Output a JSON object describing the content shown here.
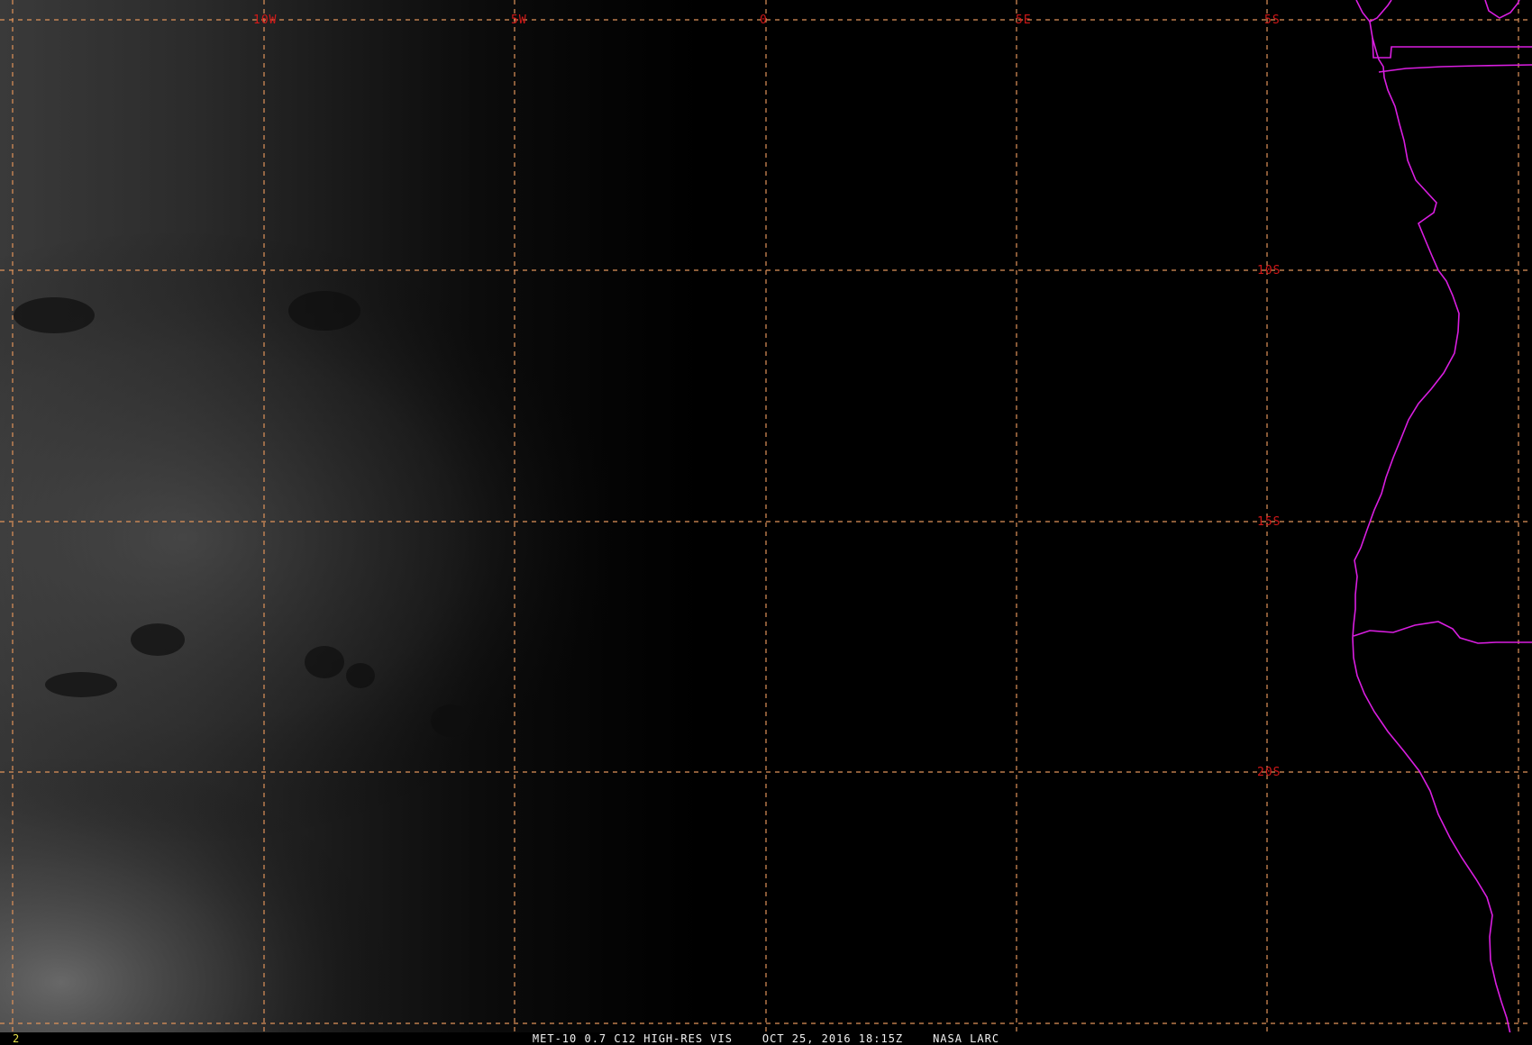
{
  "image": {
    "product": "MET-10 0.7 C12 HIGH-RES VIS",
    "datetime": "OCT 25, 2016 18:15Z",
    "source": "NASA LARC",
    "frame_number": "2"
  },
  "grid": {
    "longitude_labels": [
      "10W",
      "5W",
      "0",
      "5E"
    ],
    "latitude_labels": [
      "5S",
      "10S",
      "15S",
      "20S"
    ]
  },
  "colors": {
    "grid": "#e0935a",
    "grid_label": "#d21818",
    "country_border": "#d91ee0",
    "caption": "#f2f2f2",
    "frame_number": "#e6e04a"
  }
}
